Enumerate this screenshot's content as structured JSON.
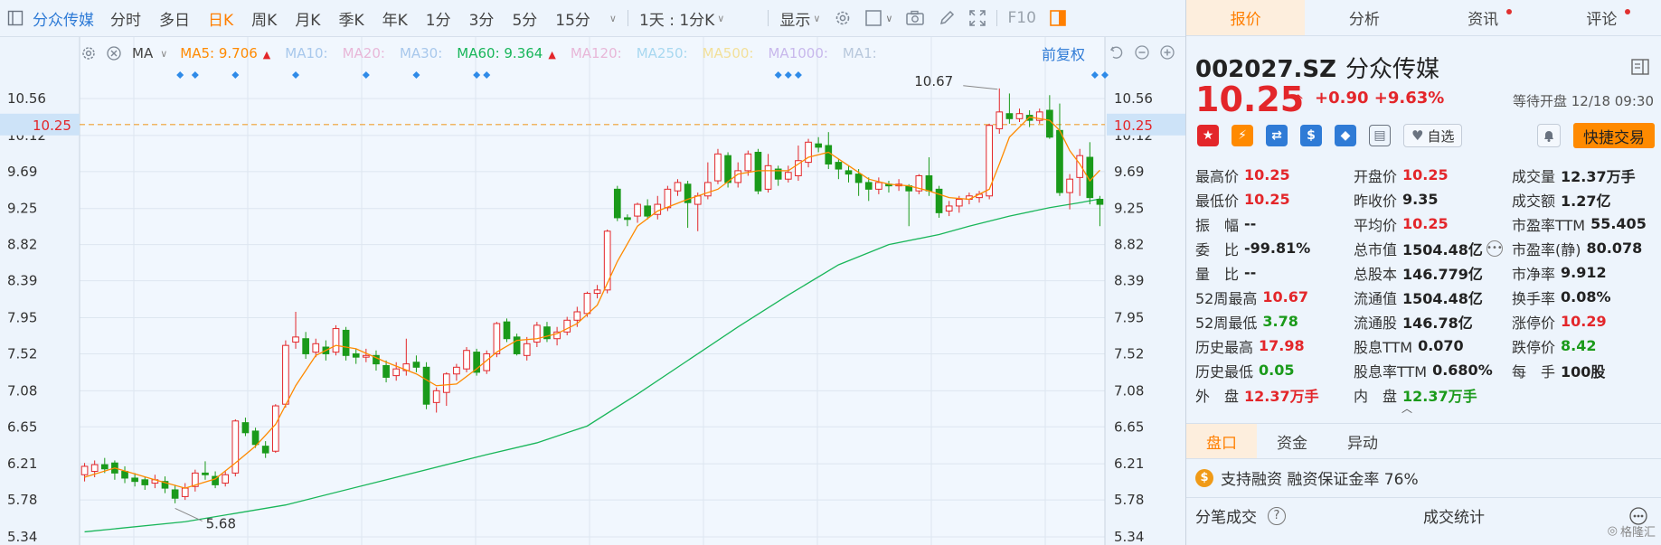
{
  "toolbar": {
    "title": "分众传媒",
    "periods": [
      "分时",
      "多日",
      "日K",
      "周K",
      "月K",
      "季K",
      "年K",
      "1分",
      "3分",
      "5分",
      "15分"
    ],
    "active_period": "日K",
    "range_dropdown": "1天 : 1分K",
    "display_dropdown": "显示",
    "f10": "F10"
  },
  "ma_bar": {
    "selector": "MA",
    "items": [
      {
        "label": "MA5:",
        "value": "9.706",
        "color": "#ff8a00",
        "trend": "up",
        "dim": false
      },
      {
        "label": "MA10:",
        "value": "",
        "color": "#a8c8ec",
        "trend": "",
        "dim": true
      },
      {
        "label": "MA20:",
        "value": "",
        "color": "#e8b7d8",
        "trend": "",
        "dim": true
      },
      {
        "label": "MA30:",
        "value": "",
        "color": "#a8c8ec",
        "trend": "",
        "dim": true
      },
      {
        "label": "MA60:",
        "value": "9.364",
        "color": "#19b65a",
        "trend": "up",
        "dim": false
      },
      {
        "label": "MA120:",
        "value": "",
        "color": "#e8b7d8",
        "trend": "",
        "dim": true
      },
      {
        "label": "MA250:",
        "value": "",
        "color": "#a8d8f0",
        "trend": "",
        "dim": true
      },
      {
        "label": "MA500:",
        "value": "",
        "color": "#f2e09a",
        "trend": "",
        "dim": true
      },
      {
        "label": "MA1000:",
        "value": "",
        "color": "#c8b8ec",
        "trend": "",
        "dim": true
      },
      {
        "label": "MA1:",
        "value": "",
        "color": "#b8c8dc",
        "trend": "",
        "dim": true
      }
    ],
    "restore": "前复权"
  },
  "chart_data": {
    "type": "candlestick",
    "y_ticks": [
      "10.56",
      "10.12",
      "9.69",
      "9.25",
      "8.82",
      "8.39",
      "7.95",
      "7.52",
      "7.08",
      "6.65",
      "6.21",
      "5.78",
      "5.34"
    ],
    "ylim": [
      5.34,
      10.56
    ],
    "current_price_label": "10.25",
    "current_price": 10.25,
    "annotations": [
      {
        "text": "10.67",
        "value": 10.67
      },
      {
        "text": "5.68",
        "value": 5.68
      }
    ],
    "candles": [
      [
        6.08,
        6.18,
        6.22,
        6.0
      ],
      [
        6.12,
        6.2,
        6.25,
        6.05
      ],
      [
        6.2,
        6.15,
        6.28,
        6.1
      ],
      [
        6.22,
        6.1,
        6.25,
        6.02
      ],
      [
        6.12,
        6.04,
        6.18,
        5.98
      ],
      [
        6.04,
        6.0,
        6.1,
        5.94
      ],
      [
        6.02,
        5.96,
        6.06,
        5.9
      ],
      [
        5.98,
        6.02,
        6.08,
        5.92
      ],
      [
        6.0,
        5.92,
        6.06,
        5.86
      ],
      [
        5.9,
        5.8,
        5.96,
        5.74
      ],
      [
        5.82,
        5.92,
        5.98,
        5.78
      ],
      [
        5.94,
        6.1,
        6.14,
        5.88
      ],
      [
        6.1,
        6.08,
        6.24,
        6.02
      ],
      [
        6.06,
        5.96,
        6.12,
        5.92
      ],
      [
        5.98,
        6.08,
        6.12,
        5.94
      ],
      [
        6.1,
        6.72,
        6.74,
        6.06
      ],
      [
        6.7,
        6.58,
        6.76,
        6.54
      ],
      [
        6.6,
        6.44,
        6.64,
        6.4
      ],
      [
        6.42,
        6.34,
        6.48,
        6.28
      ],
      [
        6.36,
        6.9,
        6.92,
        6.34
      ],
      [
        6.92,
        7.62,
        7.68,
        6.88
      ],
      [
        7.66,
        7.72,
        8.02,
        7.58
      ],
      [
        7.7,
        7.52,
        7.78,
        7.46
      ],
      [
        7.54,
        7.64,
        7.7,
        7.48
      ],
      [
        7.6,
        7.52,
        7.68,
        7.44
      ],
      [
        7.54,
        7.82,
        7.86,
        7.5
      ],
      [
        7.8,
        7.5,
        7.84,
        7.44
      ],
      [
        7.52,
        7.48,
        7.58,
        7.4
      ],
      [
        7.48,
        7.5,
        7.58,
        7.42
      ],
      [
        7.5,
        7.4,
        7.56,
        7.32
      ],
      [
        7.38,
        7.24,
        7.44,
        7.18
      ],
      [
        7.26,
        7.34,
        7.42,
        7.2
      ],
      [
        7.32,
        7.4,
        7.7,
        7.26
      ],
      [
        7.42,
        7.36,
        7.5,
        7.3
      ],
      [
        7.36,
        6.92,
        7.42,
        6.86
      ],
      [
        6.94,
        7.08,
        7.12,
        6.82
      ],
      [
        7.06,
        7.28,
        7.3,
        6.9
      ],
      [
        7.28,
        7.36,
        7.4,
        7.2
      ],
      [
        7.34,
        7.56,
        7.6,
        7.3
      ],
      [
        7.54,
        7.3,
        7.58,
        7.26
      ],
      [
        7.32,
        7.52,
        7.56,
        7.28
      ],
      [
        7.52,
        7.88,
        7.9,
        7.48
      ],
      [
        7.9,
        7.7,
        7.94,
        7.66
      ],
      [
        7.72,
        7.52,
        7.76,
        7.5
      ],
      [
        7.5,
        7.64,
        7.72,
        7.44
      ],
      [
        7.66,
        7.86,
        7.9,
        7.6
      ],
      [
        7.84,
        7.7,
        7.9,
        7.66
      ],
      [
        7.7,
        7.78,
        7.84,
        7.62
      ],
      [
        7.78,
        7.92,
        7.96,
        7.74
      ],
      [
        7.92,
        8.02,
        8.08,
        7.84
      ],
      [
        8.0,
        8.24,
        8.26,
        7.96
      ],
      [
        8.24,
        8.28,
        8.34,
        8.18
      ],
      [
        8.28,
        8.98,
        9.0,
        8.24
      ],
      [
        9.48,
        9.14,
        9.52,
        9.1
      ],
      [
        9.14,
        9.12,
        9.18,
        9.04
      ],
      [
        9.16,
        9.3,
        9.32,
        9.08
      ],
      [
        9.28,
        9.16,
        9.36,
        9.12
      ],
      [
        9.18,
        9.3,
        9.4,
        9.12
      ],
      [
        9.26,
        9.48,
        9.52,
        9.22
      ],
      [
        9.46,
        9.56,
        9.6,
        9.4
      ],
      [
        9.54,
        9.32,
        9.58,
        9.02
      ],
      [
        9.3,
        9.4,
        9.44,
        8.98
      ],
      [
        9.4,
        9.56,
        9.8,
        9.36
      ],
      [
        9.58,
        9.9,
        9.96,
        9.54
      ],
      [
        9.88,
        9.56,
        9.92,
        9.5
      ],
      [
        9.56,
        9.7,
        9.8,
        9.5
      ],
      [
        9.7,
        9.9,
        9.94,
        9.64
      ],
      [
        9.92,
        9.46,
        9.96,
        9.42
      ],
      [
        9.48,
        9.76,
        9.9,
        9.44
      ],
      [
        9.72,
        9.6,
        9.76,
        9.52
      ],
      [
        9.6,
        9.68,
        9.76,
        9.56
      ],
      [
        9.64,
        9.82,
        10.0,
        9.58
      ],
      [
        9.8,
        10.04,
        10.08,
        9.74
      ],
      [
        10.02,
        9.98,
        10.1,
        9.92
      ],
      [
        10.0,
        9.78,
        10.16,
        9.72
      ],
      [
        9.8,
        9.72,
        9.84,
        9.6
      ],
      [
        9.7,
        9.66,
        9.76,
        9.56
      ],
      [
        9.66,
        9.56,
        9.72,
        9.4
      ],
      [
        9.56,
        9.48,
        9.62,
        9.34
      ],
      [
        9.48,
        9.56,
        9.62,
        9.42
      ],
      [
        9.54,
        9.52,
        9.58,
        9.44
      ],
      [
        9.52,
        9.54,
        9.6,
        9.46
      ],
      [
        9.52,
        9.46,
        9.54,
        9.04
      ],
      [
        9.46,
        9.64,
        9.66,
        9.42
      ],
      [
        9.64,
        9.46,
        9.86,
        9.4
      ],
      [
        9.48,
        9.2,
        9.52,
        9.14
      ],
      [
        9.22,
        9.28,
        9.34,
        9.16
      ],
      [
        9.28,
        9.36,
        9.4,
        9.2
      ],
      [
        9.36,
        9.4,
        9.44,
        9.3
      ],
      [
        9.38,
        9.42,
        9.46,
        9.32
      ],
      [
        9.4,
        10.24,
        10.26,
        9.36
      ],
      [
        10.2,
        10.4,
        10.68,
        10.14
      ],
      [
        10.38,
        10.32,
        10.62,
        10.26
      ],
      [
        10.32,
        10.38,
        10.44,
        10.28
      ],
      [
        10.36,
        10.3,
        10.42,
        10.22
      ],
      [
        10.3,
        10.4,
        10.44,
        10.26
      ],
      [
        10.42,
        10.1,
        10.6,
        10.08
      ],
      [
        10.18,
        9.44,
        10.5,
        9.4
      ],
      [
        9.44,
        9.6,
        9.66,
        9.24
      ],
      [
        9.62,
        9.88,
        9.96,
        9.4
      ],
      [
        9.86,
        9.38,
        10.04,
        9.3
      ],
      [
        9.36,
        9.3,
        9.4,
        9.04
      ]
    ],
    "ma5": [
      [
        0,
        6.05
      ],
      [
        3,
        6.16
      ],
      [
        7,
        6.02
      ],
      [
        10,
        5.92
      ],
      [
        13,
        6.03
      ],
      [
        15,
        6.22
      ],
      [
        17,
        6.42
      ],
      [
        19,
        6.68
      ],
      [
        21,
        7.14
      ],
      [
        23,
        7.5
      ],
      [
        25,
        7.62
      ],
      [
        27,
        7.58
      ],
      [
        30,
        7.42
      ],
      [
        33,
        7.28
      ],
      [
        35,
        7.14
      ],
      [
        37,
        7.16
      ],
      [
        39,
        7.34
      ],
      [
        41,
        7.54
      ],
      [
        43,
        7.68
      ],
      [
        45,
        7.7
      ],
      [
        47,
        7.76
      ],
      [
        49,
        7.88
      ],
      [
        51,
        8.1
      ],
      [
        53,
        8.62
      ],
      [
        55,
        9.04
      ],
      [
        57,
        9.22
      ],
      [
        60,
        9.36
      ],
      [
        63,
        9.48
      ],
      [
        65,
        9.66
      ],
      [
        67,
        9.7
      ],
      [
        70,
        9.7
      ],
      [
        72,
        9.86
      ],
      [
        74,
        9.92
      ],
      [
        76,
        9.76
      ],
      [
        78,
        9.6
      ],
      [
        80,
        9.54
      ],
      [
        82,
        9.52
      ],
      [
        84,
        9.46
      ],
      [
        86,
        9.38
      ],
      [
        88,
        9.36
      ],
      [
        90,
        9.48
      ],
      [
        91,
        9.78
      ],
      [
        92,
        10.1
      ],
      [
        94,
        10.34
      ],
      [
        96,
        10.3
      ],
      [
        97,
        10.18
      ],
      [
        98,
        9.94
      ],
      [
        99,
        9.78
      ],
      [
        100,
        9.58
      ],
      [
        101,
        9.706
      ]
    ],
    "ma60": [
      [
        0,
        5.4
      ],
      [
        10,
        5.52
      ],
      [
        20,
        5.72
      ],
      [
        30,
        6.02
      ],
      [
        40,
        6.32
      ],
      [
        45,
        6.46
      ],
      [
        50,
        6.66
      ],
      [
        55,
        7.04
      ],
      [
        60,
        7.44
      ],
      [
        65,
        7.84
      ],
      [
        70,
        8.22
      ],
      [
        75,
        8.58
      ],
      [
        80,
        8.82
      ],
      [
        85,
        8.94
      ],
      [
        88,
        9.04
      ],
      [
        92,
        9.16
      ],
      [
        96,
        9.26
      ],
      [
        99,
        9.32
      ],
      [
        101,
        9.364
      ]
    ],
    "markers": [
      9.5,
      11,
      15,
      21,
      28,
      33,
      39,
      40,
      69,
      70,
      71
    ]
  },
  "side": {
    "tabs": [
      {
        "label": "报价",
        "active": true,
        "dot": false
      },
      {
        "label": "分析",
        "active": false,
        "dot": false
      },
      {
        "label": "资讯",
        "active": false,
        "dot": true
      },
      {
        "label": "评论",
        "active": false,
        "dot": true
      }
    ],
    "code": "002027.SZ",
    "name": "分众传媒",
    "price": "10.25",
    "change": "+0.90",
    "change_pct": "+9.63%",
    "status": "等待开盘 12/18 09:30",
    "watch": "自选",
    "quick_trade": "快捷交易",
    "stats": [
      [
        {
          "l": "最高价",
          "v": "10.25",
          "c": "red"
        },
        {
          "l": "开盘价",
          "v": "10.25",
          "c": "red"
        },
        {
          "l": "成交量",
          "v": "12.37万手",
          "c": "dark"
        }
      ],
      [
        {
          "l": "最低价",
          "v": "10.25",
          "c": "red"
        },
        {
          "l": "昨收价",
          "v": "9.35",
          "c": "dark"
        },
        {
          "l": "成交额",
          "v": "1.27亿",
          "c": "dark"
        }
      ],
      [
        {
          "l": "振　幅",
          "v": "--",
          "c": "dark"
        },
        {
          "l": "平均价",
          "v": "10.25",
          "c": "red"
        },
        {
          "l": "市盈率TTM",
          "v": "55.405",
          "c": "dark"
        }
      ],
      [
        {
          "l": "委　比",
          "v": "-99.81%",
          "c": "dark"
        },
        {
          "l": "总市值",
          "v": "1504.48亿",
          "c": "dark",
          "more": true
        },
        {
          "l": "市盈率(静)",
          "v": "80.078",
          "c": "dark"
        }
      ],
      [
        {
          "l": "量　比",
          "v": "--",
          "c": "dark"
        },
        {
          "l": "总股本",
          "v": "146.779亿",
          "c": "dark"
        },
        {
          "l": "市净率",
          "v": "9.912",
          "c": "dark"
        }
      ],
      [
        {
          "l": "52周最高",
          "v": "10.67",
          "c": "red"
        },
        {
          "l": "流通值",
          "v": "1504.48亿",
          "c": "dark"
        },
        {
          "l": "换手率",
          "v": "0.08%",
          "c": "dark"
        }
      ],
      [
        {
          "l": "52周最低",
          "v": "3.78",
          "c": "green"
        },
        {
          "l": "流通股",
          "v": "146.78亿",
          "c": "dark"
        },
        {
          "l": "涨停价",
          "v": "10.29",
          "c": "red"
        }
      ],
      [
        {
          "l": "历史最高",
          "v": "17.98",
          "c": "red"
        },
        {
          "l": "股息TTM",
          "v": "0.070",
          "c": "dark"
        },
        {
          "l": "跌停价",
          "v": "8.42",
          "c": "green"
        }
      ],
      [
        {
          "l": "历史最低",
          "v": "0.05",
          "c": "green"
        },
        {
          "l": "股息率TTM",
          "v": "0.680%",
          "c": "dark"
        },
        {
          "l": "每　手",
          "v": "100股",
          "c": "dark"
        }
      ],
      [
        {
          "l": "外　盘",
          "v": "12.37万手",
          "c": "red"
        },
        {
          "l": "内　盘",
          "v": "12.37万手",
          "c": "green"
        },
        {
          "l": "",
          "v": "",
          "c": "dark"
        }
      ]
    ],
    "subtabs": [
      {
        "label": "盘口",
        "active": true
      },
      {
        "label": "资金",
        "active": false
      },
      {
        "label": "异动",
        "active": false
      }
    ],
    "margin_text": "支持融资 融资保证金率 76%",
    "bottom_left": "分笔成交",
    "bottom_right": "成交统计",
    "watermark": "格隆汇"
  },
  "colors": {
    "up": "#e3262a",
    "down": "#1a9a1a",
    "accent": "#ff7f00",
    "link": "#2f7bd6"
  }
}
